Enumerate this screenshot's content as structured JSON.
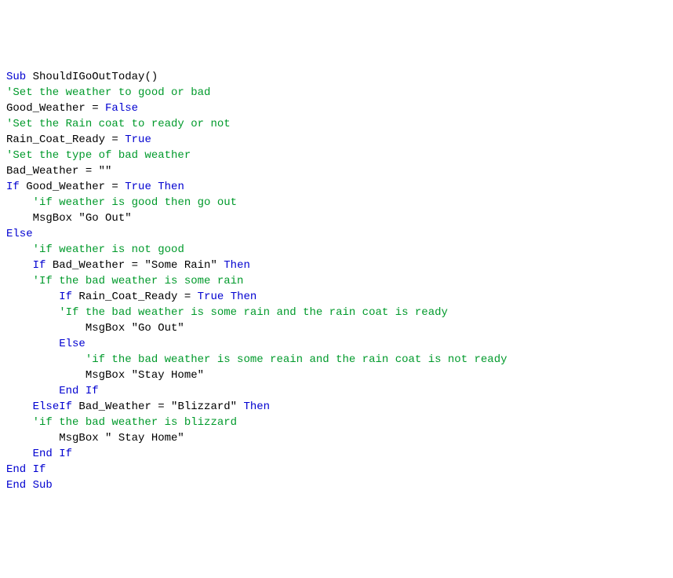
{
  "code": {
    "lines": [
      [
        {
          "t": "Sub",
          "c": "kw"
        },
        {
          "t": " ShouldIGoOutToday()",
          "c": ""
        }
      ],
      [
        {
          "t": "'Set the weather to good or bad",
          "c": "com"
        }
      ],
      [
        {
          "t": "Good_Weather = ",
          "c": ""
        },
        {
          "t": "False",
          "c": "kw"
        }
      ],
      [
        {
          "t": "'Set the Rain coat to ready or not",
          "c": "com"
        }
      ],
      [
        {
          "t": "Rain_Coat_Ready = ",
          "c": ""
        },
        {
          "t": "True",
          "c": "kw"
        }
      ],
      [
        {
          "t": "'Set the type of bad weather",
          "c": "com"
        }
      ],
      [
        {
          "t": "Bad_Weather = \"\"",
          "c": ""
        }
      ],
      [
        {
          "t": "If",
          "c": "kw"
        },
        {
          "t": " Good_Weather = ",
          "c": ""
        },
        {
          "t": "True",
          "c": "kw"
        },
        {
          "t": " ",
          "c": ""
        },
        {
          "t": "Then",
          "c": "kw"
        }
      ],
      [
        {
          "t": "    ",
          "c": ""
        },
        {
          "t": "'if weather is good then go out",
          "c": "com"
        }
      ],
      [
        {
          "t": "    MsgBox \"Go Out\"",
          "c": ""
        }
      ],
      [
        {
          "t": "Else",
          "c": "kw"
        }
      ],
      [
        {
          "t": "    ",
          "c": ""
        },
        {
          "t": "'if weather is not good",
          "c": "com"
        }
      ],
      [
        {
          "t": "    ",
          "c": ""
        },
        {
          "t": "If",
          "c": "kw"
        },
        {
          "t": " Bad_Weather = \"Some Rain\" ",
          "c": ""
        },
        {
          "t": "Then",
          "c": "kw"
        }
      ],
      [
        {
          "t": "    ",
          "c": ""
        },
        {
          "t": "'If the bad weather is some rain",
          "c": "com"
        }
      ],
      [
        {
          "t": "        ",
          "c": ""
        },
        {
          "t": "If",
          "c": "kw"
        },
        {
          "t": " Rain_Coat_Ready = ",
          "c": ""
        },
        {
          "t": "True",
          "c": "kw"
        },
        {
          "t": " ",
          "c": ""
        },
        {
          "t": "Then",
          "c": "kw"
        }
      ],
      [
        {
          "t": "        ",
          "c": ""
        },
        {
          "t": "'If the bad weather is some rain and the rain coat is ready",
          "c": "com"
        }
      ],
      [
        {
          "t": "            MsgBox \"Go Out\"",
          "c": ""
        }
      ],
      [
        {
          "t": "        ",
          "c": ""
        },
        {
          "t": "Else",
          "c": "kw"
        }
      ],
      [
        {
          "t": "            ",
          "c": ""
        },
        {
          "t": "'if the bad weather is some reain and the rain coat is not ready",
          "c": "com"
        }
      ],
      [
        {
          "t": "            MsgBox \"Stay Home\"",
          "c": ""
        }
      ],
      [
        {
          "t": "        ",
          "c": ""
        },
        {
          "t": "End",
          "c": "kw"
        },
        {
          "t": " ",
          "c": ""
        },
        {
          "t": "If",
          "c": "kw"
        }
      ],
      [
        {
          "t": "    ",
          "c": ""
        },
        {
          "t": "ElseIf",
          "c": "kw"
        },
        {
          "t": " Bad_Weather = \"Blizzard\" ",
          "c": ""
        },
        {
          "t": "Then",
          "c": "kw"
        }
      ],
      [
        {
          "t": "    ",
          "c": ""
        },
        {
          "t": "'if the bad weather is blizzard",
          "c": "com"
        }
      ],
      [
        {
          "t": "        MsgBox \" Stay Home\"",
          "c": ""
        }
      ],
      [
        {
          "t": "    ",
          "c": ""
        },
        {
          "t": "End",
          "c": "kw"
        },
        {
          "t": " ",
          "c": ""
        },
        {
          "t": "If",
          "c": "kw"
        }
      ],
      [
        {
          "t": "End",
          "c": "kw"
        },
        {
          "t": " ",
          "c": ""
        },
        {
          "t": "If",
          "c": "kw"
        }
      ],
      [
        {
          "t": "End",
          "c": "kw"
        },
        {
          "t": " ",
          "c": ""
        },
        {
          "t": "Sub",
          "c": "kw"
        }
      ]
    ]
  }
}
